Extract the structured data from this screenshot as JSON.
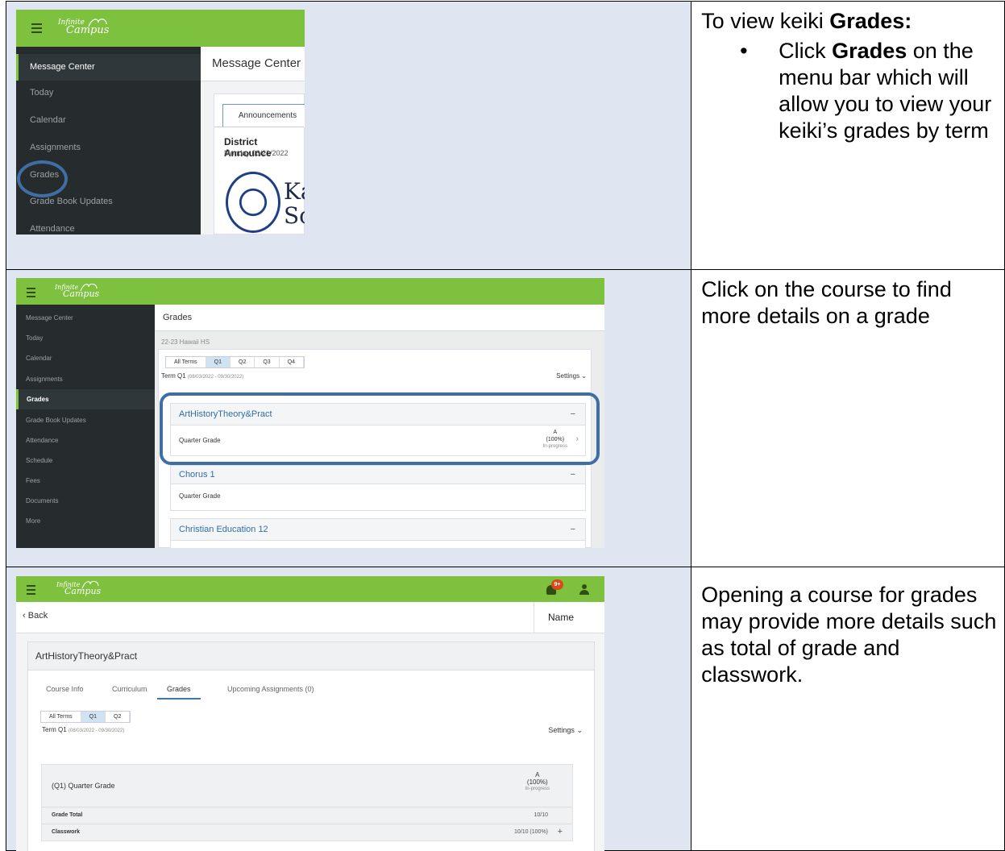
{
  "row1": {
    "instruction": {
      "prefix": "To view keiki ",
      "bold": "Grades:",
      "bullet_bold": "Grades",
      "bullet_before": "Click ",
      "bullet_after": " on the menu bar which will allow you to view your keiki’s grades by term"
    },
    "app": {
      "logo_line1": "Infinite",
      "logo_line2": "Campus",
      "sidebar": [
        "Message Center",
        "Today",
        "Calendar",
        "Assignments",
        "Grades",
        "Grade Book Updates",
        "Attendance"
      ],
      "page_title": "Message Center",
      "tab_label": "Announcements",
      "announcement_title": "District Announce",
      "announcement_date": "Monday 03/21/2022",
      "school_text_1": "Ka",
      "school_text_2": "Sc"
    }
  },
  "row2": {
    "instruction": "Click on the course to find more details on a grade",
    "app": {
      "logo_line1": "Infinite",
      "logo_line2": "Campus",
      "sidebar": [
        "Message Center",
        "Today",
        "Calendar",
        "Assignments",
        "Grades",
        "Grade Book Updates",
        "Attendance",
        "Schedule",
        "Fees",
        "Documents",
        "More"
      ],
      "page_title": "Grades",
      "school_year": "22-23 Hawaii HS",
      "term_tabs": [
        "All Terms",
        "Q1",
        "Q2",
        "Q3",
        "Q4"
      ],
      "term_label": "Term Q1",
      "term_dates": "(08/03/2022 - 09/30/2022)",
      "settings_label": "Settings",
      "courses": [
        {
          "name": "ArtHistoryTheory&Pract",
          "row_label": "Quarter Grade",
          "grade": "A",
          "percent": "(100%)",
          "status": "In-progress"
        },
        {
          "name": "Chorus 1",
          "row_label": "Quarter Grade"
        },
        {
          "name": "Christian Education 12"
        }
      ]
    }
  },
  "row3": {
    "instruction": "Opening a course for grades may provide more details such as total of grade and classwork.",
    "app": {
      "logo_line1": "Infinite",
      "logo_line2": "Campus",
      "notification_badge": "9+",
      "back_label": "Back",
      "name_label": "Name",
      "course_title": "ArtHistoryTheory&Pract",
      "tabs": [
        "Course Info",
        "Curriculum",
        "Grades",
        "Upcoming Assignments (0)"
      ],
      "term_tabs": [
        "All Terms",
        "Q1",
        "Q2"
      ],
      "term_label": "Term Q1",
      "term_dates": "(08/03/2022 - 09/30/2022)",
      "settings_label": "Settings",
      "quarter_grade_label": "(Q1) Quarter Grade",
      "grade": "A",
      "percent": "(100%)",
      "status": "In-progress",
      "grade_total_label": "Grade Total",
      "grade_total_value": "10/10",
      "classwork_label": "Classwork",
      "classwork_value": "10/10 (100%)"
    }
  }
}
